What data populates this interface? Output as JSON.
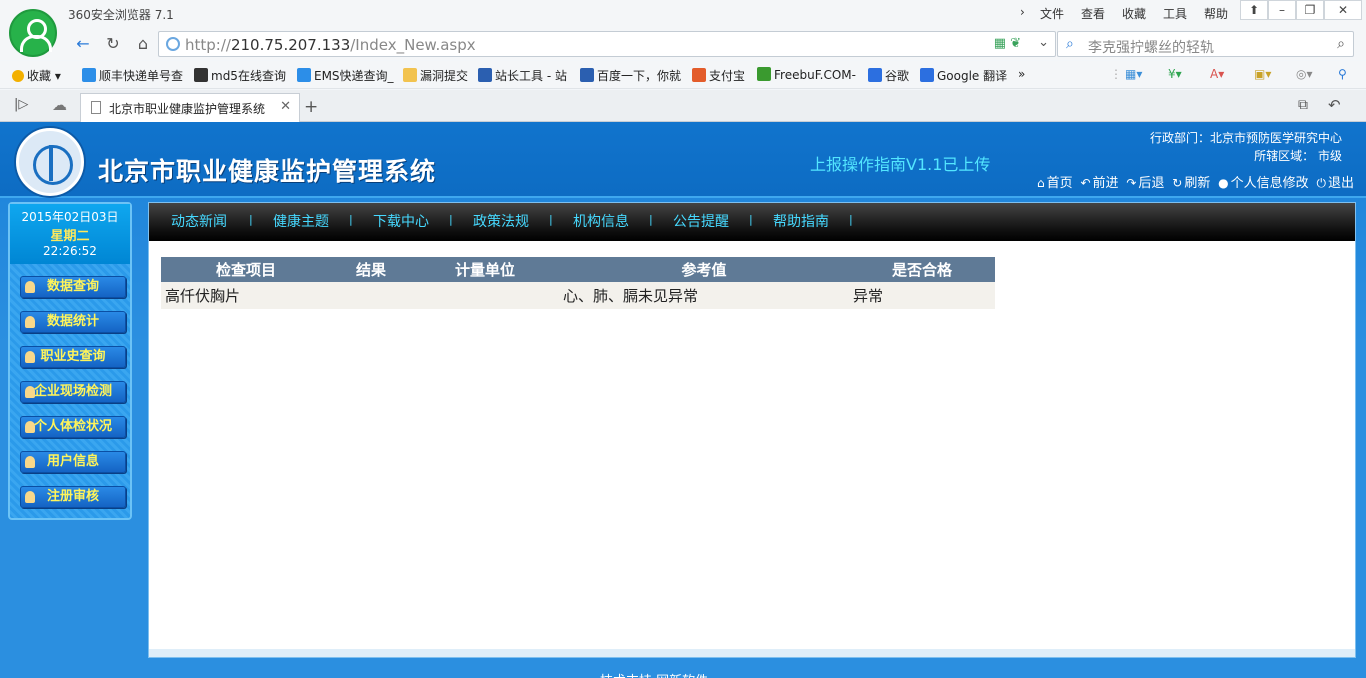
{
  "browser": {
    "app_title": "360安全浏览器 7.1",
    "menu": [
      "文件",
      "查看",
      "收藏",
      "工具",
      "帮助"
    ],
    "address": {
      "scheme": "http://",
      "host": "210.75.207.133",
      "path": "/Index_New.aspx"
    },
    "search_placeholder": "李克强拧螺丝的轻轨",
    "bookmarks": [
      {
        "label": "收藏",
        "color": "#f3b000"
      },
      {
        "label": "顺丰快递单号查",
        "color": "#2c8ee8"
      },
      {
        "label": "md5在线查询",
        "color": "#333333"
      },
      {
        "label": "EMS快递查询_",
        "color": "#2c8ee8"
      },
      {
        "label": "漏洞提交",
        "color": "#f2c34f"
      },
      {
        "label": "站长工具 - 站",
        "color": "#2b5fb0"
      },
      {
        "label": "百度一下，你就",
        "color": "#2b5fb0"
      },
      {
        "label": "支付宝",
        "color": "#e35c2b"
      },
      {
        "label": "FreebuF.COM-",
        "color": "#3a9a2f"
      },
      {
        "label": "谷歌",
        "color": "#2c6fe0"
      },
      {
        "label": "Google 翻译",
        "color": "#2c6fe0"
      }
    ],
    "tab_title": "北京市职业健康监护管理系统"
  },
  "header": {
    "site_title": "北京市职业健康监护管理系统",
    "notice": "上报操作指南V1.1已上传",
    "dept": "行政部门：北京市预防医学研究中心",
    "region": "所辖区域：  市级",
    "toolbar": [
      {
        "label": "首页",
        "icon": "home-icon",
        "glyph": "⌂"
      },
      {
        "label": "前进",
        "icon": "forward-icon",
        "glyph": "↶"
      },
      {
        "label": "后退",
        "icon": "back-icon",
        "glyph": "↷"
      },
      {
        "label": "刷新",
        "icon": "refresh-icon",
        "glyph": "↻"
      },
      {
        "label": "个人信息修改",
        "icon": "user-icon",
        "glyph": "●"
      },
      {
        "label": "退出",
        "icon": "power-icon",
        "glyph": "⏻"
      }
    ]
  },
  "sidebar": {
    "date": "2015年02日03日",
    "weekday": "星期二",
    "time": "22:26:52",
    "items": [
      "数据查询",
      "数据统计",
      "职业史查询",
      "企业现场检测",
      "个人体检状况",
      "用户信息",
      "注册审核"
    ]
  },
  "nav": [
    "动态新闻",
    "健康主题",
    "下载中心",
    "政策法规",
    "机构信息",
    "公告提醒",
    "帮助指南"
  ],
  "table": {
    "headers": [
      "检查项目",
      "结果",
      "计量单位",
      "参考值",
      "是否合格"
    ],
    "rows": [
      [
        "高仟伏胸片",
        "",
        "",
        "心、肺、膈未见异常",
        "异常"
      ]
    ]
  },
  "footer": "技术支持    网新软件"
}
